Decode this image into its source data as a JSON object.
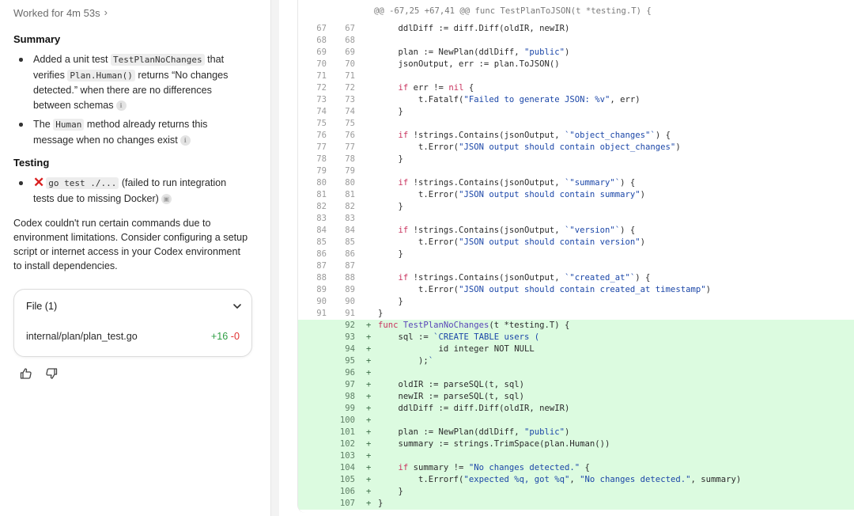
{
  "header": {
    "worked_label": "Worked for 4m 53s"
  },
  "summary": {
    "title": "Summary",
    "items": [
      {
        "pre": "Added a unit test ",
        "code1": "TestPlanNoChanges",
        "mid1": " that verifies ",
        "code2": "Plan.Human()",
        "post": " returns “No changes detected.” when there are no differences between schemas"
      },
      {
        "pre": "The ",
        "code1": "Human",
        "post": " method already returns this message when no changes exist"
      }
    ]
  },
  "testing": {
    "title": "Testing",
    "item": {
      "code": "go test ./...",
      "post": " (failed to run integration tests due to missing Docker)"
    }
  },
  "note": "Codex couldn't run certain commands due to environment limitations. Consider configuring a setup script or internet access in your Codex environment to install dependencies.",
  "file_card": {
    "title": "File (1)",
    "file_name": "internal/plan/plan_test.go",
    "additions": "+16",
    "deletions": "-0"
  },
  "colors": {
    "add_bg": "#dcfbe0",
    "add_count": "#2f9e44",
    "del_count": "#e03131",
    "error_x": "#d92020"
  },
  "diff": {
    "hunk_header": "@@ -67,25 +67,41 @@ func TestPlanToJSON(t *testing.T) {",
    "lines": [
      {
        "old": "67",
        "new": "67",
        "sign": "",
        "code": "    ddlDiff := diff.Diff(oldIR, newIR)"
      },
      {
        "old": "68",
        "new": "68",
        "sign": "",
        "code": ""
      },
      {
        "old": "69",
        "new": "69",
        "sign": "",
        "code": "    plan := NewPlan(ddlDiff, \"public\")"
      },
      {
        "old": "70",
        "new": "70",
        "sign": "",
        "code": "    jsonOutput, err := plan.ToJSON()"
      },
      {
        "old": "71",
        "new": "71",
        "sign": "",
        "code": ""
      },
      {
        "old": "72",
        "new": "72",
        "sign": "",
        "code": "    if err != nil {"
      },
      {
        "old": "73",
        "new": "73",
        "sign": "",
        "code": "        t.Fatalf(\"Failed to generate JSON: %v\", err)"
      },
      {
        "old": "74",
        "new": "74",
        "sign": "",
        "code": "    }"
      },
      {
        "old": "75",
        "new": "75",
        "sign": "",
        "code": ""
      },
      {
        "old": "76",
        "new": "76",
        "sign": "",
        "code": "    if !strings.Contains(jsonOutput, `\"object_changes\"`) {"
      },
      {
        "old": "77",
        "new": "77",
        "sign": "",
        "code": "        t.Error(\"JSON output should contain object_changes\")"
      },
      {
        "old": "78",
        "new": "78",
        "sign": "",
        "code": "    }"
      },
      {
        "old": "79",
        "new": "79",
        "sign": "",
        "code": ""
      },
      {
        "old": "80",
        "new": "80",
        "sign": "",
        "code": "    if !strings.Contains(jsonOutput, `\"summary\"`) {"
      },
      {
        "old": "81",
        "new": "81",
        "sign": "",
        "code": "        t.Error(\"JSON output should contain summary\")"
      },
      {
        "old": "82",
        "new": "82",
        "sign": "",
        "code": "    }"
      },
      {
        "old": "83",
        "new": "83",
        "sign": "",
        "code": ""
      },
      {
        "old": "84",
        "new": "84",
        "sign": "",
        "code": "    if !strings.Contains(jsonOutput, `\"version\"`) {"
      },
      {
        "old": "85",
        "new": "85",
        "sign": "",
        "code": "        t.Error(\"JSON output should contain version\")"
      },
      {
        "old": "86",
        "new": "86",
        "sign": "",
        "code": "    }"
      },
      {
        "old": "87",
        "new": "87",
        "sign": "",
        "code": ""
      },
      {
        "old": "88",
        "new": "88",
        "sign": "",
        "code": "    if !strings.Contains(jsonOutput, `\"created_at\"`) {"
      },
      {
        "old": "89",
        "new": "89",
        "sign": "",
        "code": "        t.Error(\"JSON output should contain created_at timestamp\")"
      },
      {
        "old": "90",
        "new": "90",
        "sign": "",
        "code": "    }"
      },
      {
        "old": "91",
        "new": "91",
        "sign": "",
        "code": "}"
      },
      {
        "old": "",
        "new": "92",
        "sign": "+",
        "code": "func TestPlanNoChanges(t *testing.T) {"
      },
      {
        "old": "",
        "new": "93",
        "sign": "+",
        "code": "    sql := `CREATE TABLE users ("
      },
      {
        "old": "",
        "new": "94",
        "sign": "+",
        "code": "            id integer NOT NULL"
      },
      {
        "old": "",
        "new": "95",
        "sign": "+",
        "code": "        );`"
      },
      {
        "old": "",
        "new": "96",
        "sign": "+",
        "code": ""
      },
      {
        "old": "",
        "new": "97",
        "sign": "+",
        "code": "    oldIR := parseSQL(t, sql)"
      },
      {
        "old": "",
        "new": "98",
        "sign": "+",
        "code": "    newIR := parseSQL(t, sql)"
      },
      {
        "old": "",
        "new": "99",
        "sign": "+",
        "code": "    ddlDiff := diff.Diff(oldIR, newIR)"
      },
      {
        "old": "",
        "new": "100",
        "sign": "+",
        "code": ""
      },
      {
        "old": "",
        "new": "101",
        "sign": "+",
        "code": "    plan := NewPlan(ddlDiff, \"public\")"
      },
      {
        "old": "",
        "new": "102",
        "sign": "+",
        "code": "    summary := strings.TrimSpace(plan.Human())"
      },
      {
        "old": "",
        "new": "103",
        "sign": "+",
        "code": ""
      },
      {
        "old": "",
        "new": "104",
        "sign": "+",
        "code": "    if summary != \"No changes detected.\" {"
      },
      {
        "old": "",
        "new": "105",
        "sign": "+",
        "code": "        t.Errorf(\"expected %q, got %q\", \"No changes detected.\", summary)"
      },
      {
        "old": "",
        "new": "106",
        "sign": "+",
        "code": "    }"
      },
      {
        "old": "",
        "new": "107",
        "sign": "+",
        "code": "}"
      }
    ]
  }
}
